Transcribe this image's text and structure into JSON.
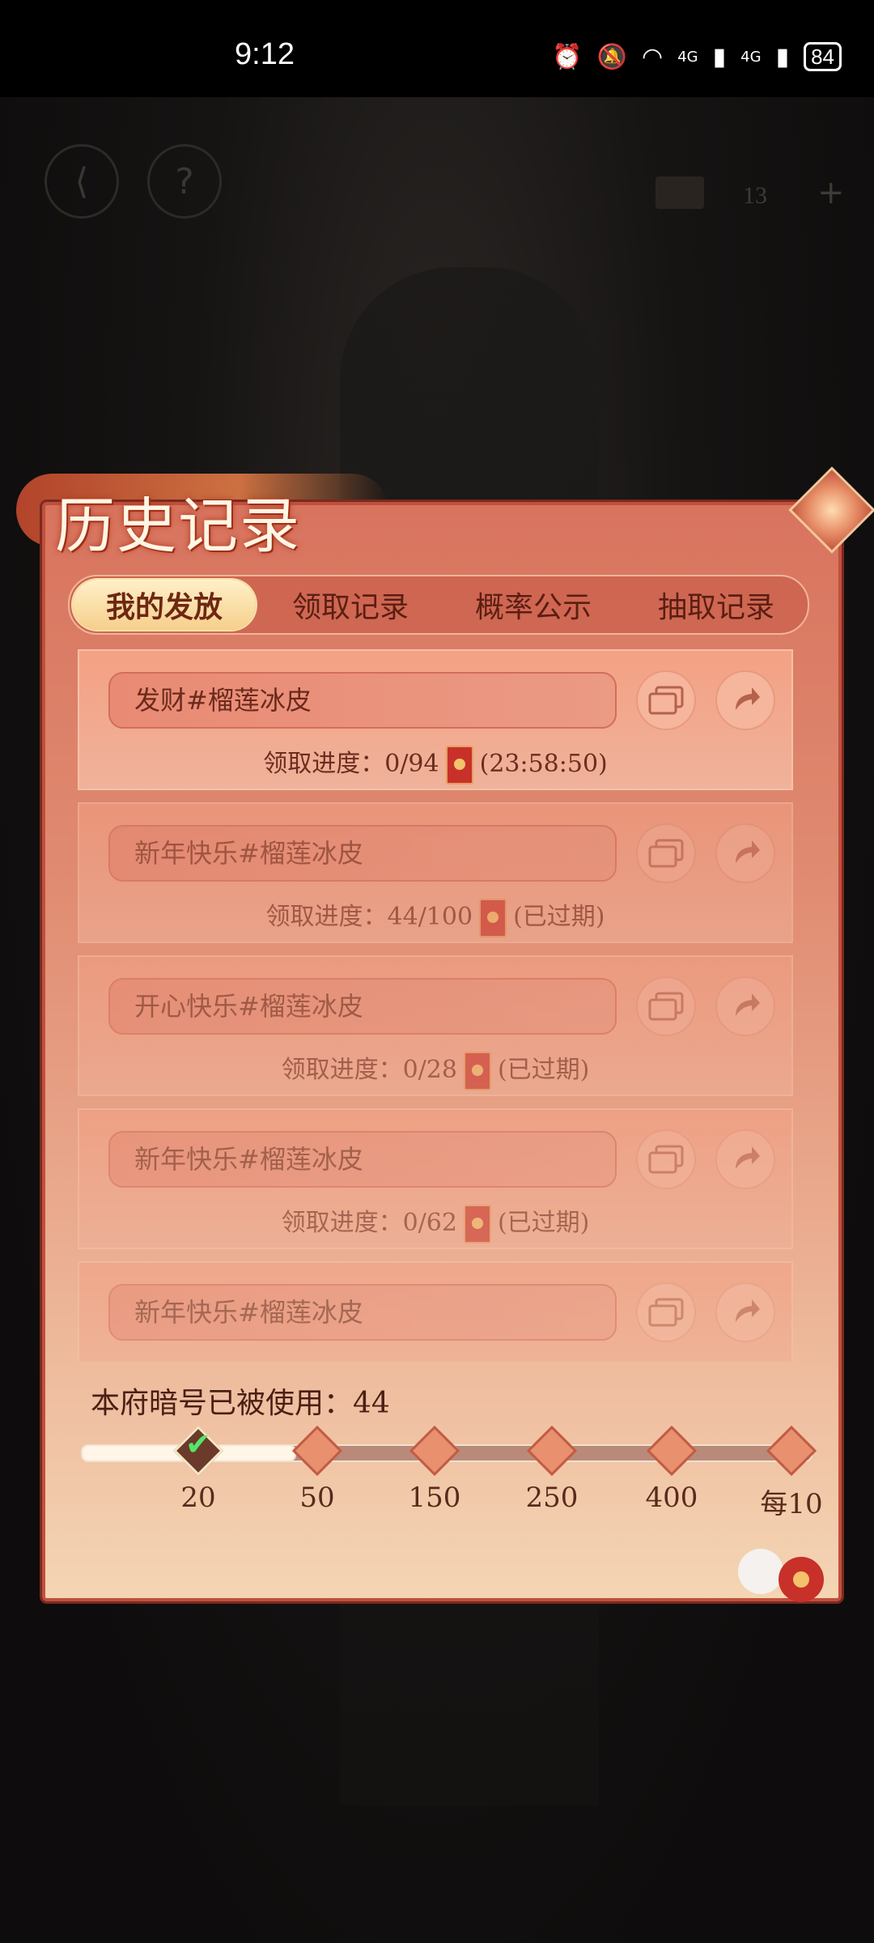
{
  "status_bar": {
    "time": "9:12",
    "network_1": "4G",
    "network_2": "4G",
    "battery": "84"
  },
  "top_bar": {
    "back_icon": "back-arrow-icon",
    "help_label": "?",
    "currency_count": "13",
    "add_label": "+"
  },
  "panel": {
    "title": "历史记录",
    "tabs": [
      {
        "label": "我的发放",
        "active": true
      },
      {
        "label": "领取记录",
        "active": false
      },
      {
        "label": "概率公示",
        "active": false
      },
      {
        "label": "抽取记录",
        "active": false
      }
    ],
    "records": [
      {
        "code": "发财#榴莲冰皮",
        "progress_label": "领取进度：0/94",
        "status": "(23:58:50)",
        "expired": false
      },
      {
        "code": "新年快乐#榴莲冰皮",
        "progress_label": "领取进度：44/100",
        "status": "(已过期)",
        "expired": true
      },
      {
        "code": "开心快乐#榴莲冰皮",
        "progress_label": "领取进度：0/28",
        "status": "(已过期)",
        "expired": true
      },
      {
        "code": "新年快乐#榴莲冰皮",
        "progress_label": "领取进度：0/62",
        "status": "(已过期)",
        "expired": true
      },
      {
        "code": "新年快乐#榴莲冰皮",
        "progress_label": "",
        "status": "",
        "expired": true
      }
    ],
    "usage_label": "本府暗号已被使用：44",
    "usage_value": 44,
    "milestones": [
      {
        "label": "20",
        "reached": true
      },
      {
        "label": "50",
        "reached": false
      },
      {
        "label": "150",
        "reached": false
      },
      {
        "label": "250",
        "reached": false
      },
      {
        "label": "400",
        "reached": false
      },
      {
        "label": "每10",
        "reached": false
      }
    ]
  },
  "colors": {
    "accent": "#d8735e",
    "tab_active": "#f6cf8c",
    "text_dark": "#5b1e12"
  }
}
